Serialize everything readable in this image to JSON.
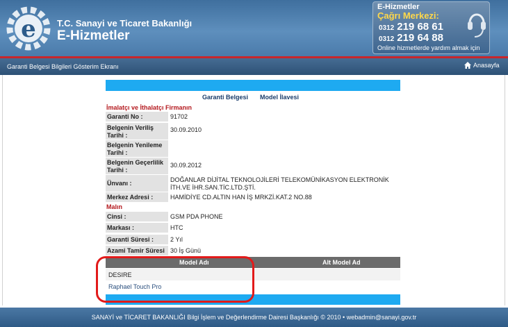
{
  "header": {
    "org_title": "T.C. Sanayi ve Ticaret Bakanlığı",
    "app_title": "E-Hizmetler",
    "callbox": {
      "title": "E-Hizmetler",
      "center": "Çağrı Merkezi:",
      "phones": [
        {
          "area": "0312",
          "number": "219 68 61"
        },
        {
          "area": "0312",
          "number": "219 64 88"
        }
      ],
      "note": "Online hizmetlerde yardım almak için"
    }
  },
  "navbar": {
    "page_label": "Garanti Belgesi Bilgileri Gösterim Ekranı",
    "home_label": "Anasayfa"
  },
  "tabs": [
    "Garanti Belgesi",
    "Model İlavesi"
  ],
  "sections": {
    "firm": "İmalatçı ve İthalatçı Firmanın",
    "product": "Malın"
  },
  "fields": [
    {
      "label": "Garanti No :",
      "value": "91702"
    },
    {
      "label": "Belgenin Veriliş Tarihi :",
      "value": "30.09.2010"
    },
    {
      "label": "Belgenin Yenileme Tarihi :",
      "value": ""
    },
    {
      "label": "Belgenin Geçerlilik Tarihi :",
      "value": "30.09.2012"
    },
    {
      "label": "Ünvanı :",
      "value": "DOĞANLAR DİJİTAL TEKNOLOJİLERİ TELEKOMÜNİKASYON ELEKTRONİK İTH.VE İHR.SAN.TİC.LTD.ŞTİ."
    },
    {
      "label": "Merkez Adresi :",
      "value": "HAMİDİYE CD.ALTIN HAN İŞ MRKZİ.KAT.2 NO.88"
    }
  ],
  "product_fields": [
    {
      "label": "Cinsi :",
      "value": "GSM PDA PHONE"
    },
    {
      "label": "Markası :",
      "value": "HTC"
    },
    {
      "label": "Garanti Süresi :",
      "value": "2 Yıl"
    },
    {
      "label": "Azami Tamir Süresi :",
      "value": "30 İş Günü"
    }
  ],
  "model_table": {
    "headers": [
      "Model Adı",
      "Alt Model Ad"
    ],
    "rows": [
      "DESIRE",
      "Raphael Touch Pro"
    ]
  },
  "footer": {
    "text": "SANAYİ ve TİCARET BAKANLIĞI Bilgi İşlem ve Değerlendirme Dairesi Başkanlığı © 2010 • webadmin@sanayi.gov.tr"
  },
  "colors": {
    "accent_cyan": "#1eaaf1",
    "section_red": "#b4191e",
    "header_blue": "#4a7aaa",
    "highlight_red": "#e21a1a"
  }
}
